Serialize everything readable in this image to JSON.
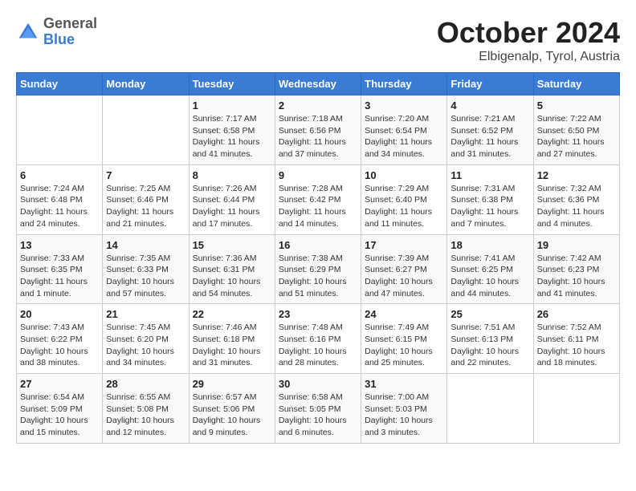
{
  "header": {
    "logo_general": "General",
    "logo_blue": "Blue",
    "title": "October 2024",
    "subtitle": "Elbigenalp, Tyrol, Austria"
  },
  "weekdays": [
    "Sunday",
    "Monday",
    "Tuesday",
    "Wednesday",
    "Thursday",
    "Friday",
    "Saturday"
  ],
  "weeks": [
    [
      {
        "day": "",
        "info": ""
      },
      {
        "day": "",
        "info": ""
      },
      {
        "day": "1",
        "info": "Sunrise: 7:17 AM\nSunset: 6:58 PM\nDaylight: 11 hours and 41 minutes."
      },
      {
        "day": "2",
        "info": "Sunrise: 7:18 AM\nSunset: 6:56 PM\nDaylight: 11 hours and 37 minutes."
      },
      {
        "day": "3",
        "info": "Sunrise: 7:20 AM\nSunset: 6:54 PM\nDaylight: 11 hours and 34 minutes."
      },
      {
        "day": "4",
        "info": "Sunrise: 7:21 AM\nSunset: 6:52 PM\nDaylight: 11 hours and 31 minutes."
      },
      {
        "day": "5",
        "info": "Sunrise: 7:22 AM\nSunset: 6:50 PM\nDaylight: 11 hours and 27 minutes."
      }
    ],
    [
      {
        "day": "6",
        "info": "Sunrise: 7:24 AM\nSunset: 6:48 PM\nDaylight: 11 hours and 24 minutes."
      },
      {
        "day": "7",
        "info": "Sunrise: 7:25 AM\nSunset: 6:46 PM\nDaylight: 11 hours and 21 minutes."
      },
      {
        "day": "8",
        "info": "Sunrise: 7:26 AM\nSunset: 6:44 PM\nDaylight: 11 hours and 17 minutes."
      },
      {
        "day": "9",
        "info": "Sunrise: 7:28 AM\nSunset: 6:42 PM\nDaylight: 11 hours and 14 minutes."
      },
      {
        "day": "10",
        "info": "Sunrise: 7:29 AM\nSunset: 6:40 PM\nDaylight: 11 hours and 11 minutes."
      },
      {
        "day": "11",
        "info": "Sunrise: 7:31 AM\nSunset: 6:38 PM\nDaylight: 11 hours and 7 minutes."
      },
      {
        "day": "12",
        "info": "Sunrise: 7:32 AM\nSunset: 6:36 PM\nDaylight: 11 hours and 4 minutes."
      }
    ],
    [
      {
        "day": "13",
        "info": "Sunrise: 7:33 AM\nSunset: 6:35 PM\nDaylight: 11 hours and 1 minute."
      },
      {
        "day": "14",
        "info": "Sunrise: 7:35 AM\nSunset: 6:33 PM\nDaylight: 10 hours and 57 minutes."
      },
      {
        "day": "15",
        "info": "Sunrise: 7:36 AM\nSunset: 6:31 PM\nDaylight: 10 hours and 54 minutes."
      },
      {
        "day": "16",
        "info": "Sunrise: 7:38 AM\nSunset: 6:29 PM\nDaylight: 10 hours and 51 minutes."
      },
      {
        "day": "17",
        "info": "Sunrise: 7:39 AM\nSunset: 6:27 PM\nDaylight: 10 hours and 47 minutes."
      },
      {
        "day": "18",
        "info": "Sunrise: 7:41 AM\nSunset: 6:25 PM\nDaylight: 10 hours and 44 minutes."
      },
      {
        "day": "19",
        "info": "Sunrise: 7:42 AM\nSunset: 6:23 PM\nDaylight: 10 hours and 41 minutes."
      }
    ],
    [
      {
        "day": "20",
        "info": "Sunrise: 7:43 AM\nSunset: 6:22 PM\nDaylight: 10 hours and 38 minutes."
      },
      {
        "day": "21",
        "info": "Sunrise: 7:45 AM\nSunset: 6:20 PM\nDaylight: 10 hours and 34 minutes."
      },
      {
        "day": "22",
        "info": "Sunrise: 7:46 AM\nSunset: 6:18 PM\nDaylight: 10 hours and 31 minutes."
      },
      {
        "day": "23",
        "info": "Sunrise: 7:48 AM\nSunset: 6:16 PM\nDaylight: 10 hours and 28 minutes."
      },
      {
        "day": "24",
        "info": "Sunrise: 7:49 AM\nSunset: 6:15 PM\nDaylight: 10 hours and 25 minutes."
      },
      {
        "day": "25",
        "info": "Sunrise: 7:51 AM\nSunset: 6:13 PM\nDaylight: 10 hours and 22 minutes."
      },
      {
        "day": "26",
        "info": "Sunrise: 7:52 AM\nSunset: 6:11 PM\nDaylight: 10 hours and 18 minutes."
      }
    ],
    [
      {
        "day": "27",
        "info": "Sunrise: 6:54 AM\nSunset: 5:09 PM\nDaylight: 10 hours and 15 minutes."
      },
      {
        "day": "28",
        "info": "Sunrise: 6:55 AM\nSunset: 5:08 PM\nDaylight: 10 hours and 12 minutes."
      },
      {
        "day": "29",
        "info": "Sunrise: 6:57 AM\nSunset: 5:06 PM\nDaylight: 10 hours and 9 minutes."
      },
      {
        "day": "30",
        "info": "Sunrise: 6:58 AM\nSunset: 5:05 PM\nDaylight: 10 hours and 6 minutes."
      },
      {
        "day": "31",
        "info": "Sunrise: 7:00 AM\nSunset: 5:03 PM\nDaylight: 10 hours and 3 minutes."
      },
      {
        "day": "",
        "info": ""
      },
      {
        "day": "",
        "info": ""
      }
    ]
  ]
}
